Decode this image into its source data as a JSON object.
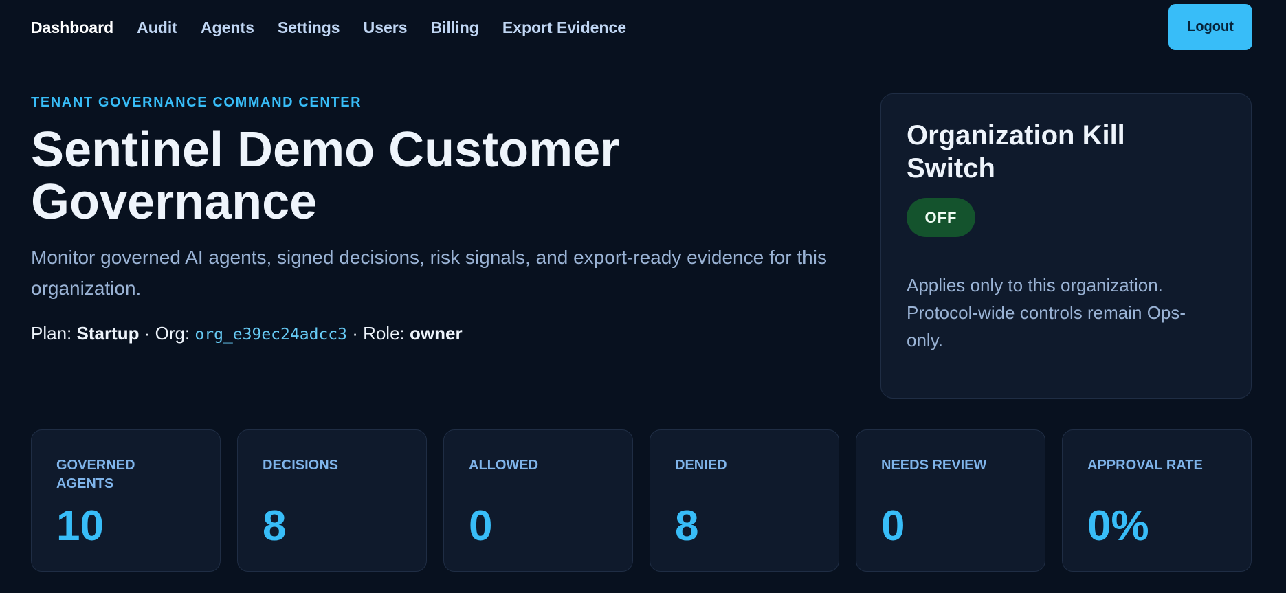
{
  "nav": {
    "items": [
      {
        "label": "Dashboard"
      },
      {
        "label": "Audit"
      },
      {
        "label": "Agents"
      },
      {
        "label": "Settings"
      },
      {
        "label": "Users"
      },
      {
        "label": "Billing"
      },
      {
        "label": "Export Evidence"
      }
    ],
    "logout_label": "Logout"
  },
  "hero": {
    "eyebrow": "TENANT GOVERNANCE COMMAND CENTER",
    "title": "Sentinel Demo Customer Governance",
    "subtitle": "Monitor governed AI agents, signed decisions, risk signals, and export-ready evidence for this organization.",
    "meta": {
      "plan_label": "Plan: ",
      "plan": "Startup",
      "org_label": " · Org: ",
      "org": "org_e39ec24adcc3",
      "role_label": " · Role: ",
      "role": "owner"
    }
  },
  "kill_switch": {
    "title": "Organization Kill Switch",
    "status": "OFF",
    "status_color": "#14532d",
    "description": "Applies only to this organization. Protocol-wide controls remain Ops-only."
  },
  "stats": [
    {
      "label": "GOVERNED AGENTS",
      "value": "10"
    },
    {
      "label": "DECISIONS",
      "value": "8"
    },
    {
      "label": "ALLOWED",
      "value": "0"
    },
    {
      "label": "DENIED",
      "value": "8"
    },
    {
      "label": "NEEDS REVIEW",
      "value": "0"
    },
    {
      "label": "APPROVAL RATE",
      "value": "0%"
    }
  ],
  "colors": {
    "background": "#08111f",
    "accent": "#38bdf8",
    "card": "#0f1a2c"
  }
}
